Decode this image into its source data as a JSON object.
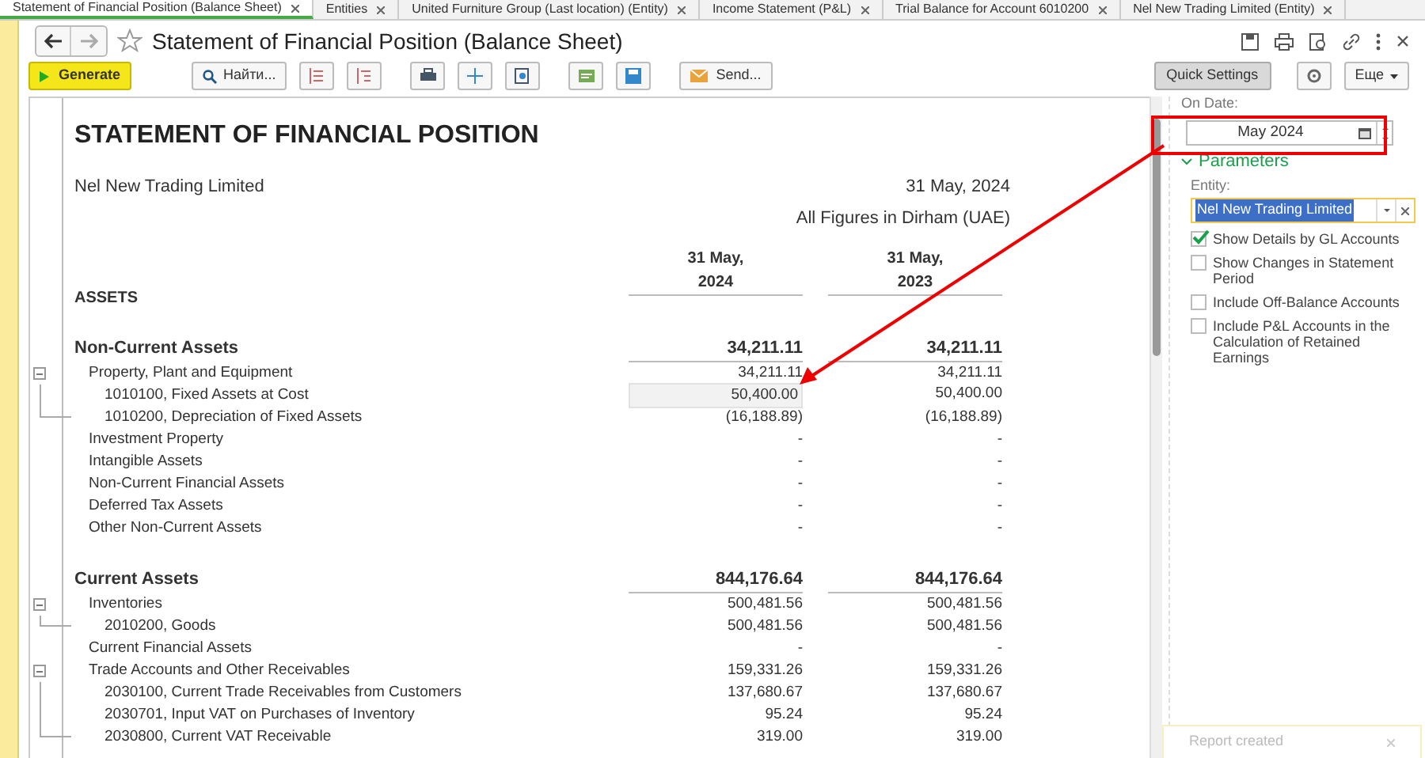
{
  "tabs": [
    {
      "label": "Statement of Financial Position (Balance Sheet)",
      "selected": true
    },
    {
      "label": "Entities",
      "selected": false
    },
    {
      "label": "United Furniture Group (Last location) (Entity)",
      "selected": false
    },
    {
      "label": "Income Statement (P&L)",
      "selected": false
    },
    {
      "label": "Trial Balance for Account 6010200",
      "selected": false
    },
    {
      "label": "Nel New Trading Limited (Entity)",
      "selected": false
    }
  ],
  "window": {
    "title": "Statement of Financial Position (Balance Sheet)"
  },
  "toolbar": {
    "generate": "Generate",
    "find": "Найти...",
    "send": "Send...",
    "quick_settings": "Quick Settings",
    "more": "Еще"
  },
  "report": {
    "title": "STATEMENT OF FINANCIAL POSITION",
    "entity": "Nel New Trading Limited",
    "date": "31 May, 2024",
    "currency_note": "All Figures in Dirham (UAE)",
    "columns": [
      "31 May,\n2024",
      "31 May,\n2023"
    ],
    "rows": [
      {
        "kind": "heading",
        "label": "ASSETS"
      },
      {
        "kind": "section",
        "label": "Non-Current Assets",
        "values": [
          "34,211.11",
          "34,211.11"
        ]
      },
      {
        "kind": "group",
        "label": "Property, Plant and Equipment",
        "values": [
          "34,211.11",
          "34,211.11"
        ],
        "expanded": true,
        "children": [
          {
            "kind": "account",
            "label": "1010100, Fixed Assets at Cost",
            "values": [
              "50,400.00",
              "50,400.00"
            ],
            "selected": true
          },
          {
            "kind": "account",
            "label": "1010200, Depreciation of Fixed Assets",
            "values": [
              "(16,188.89)",
              "(16,188.89)"
            ],
            "selected": false
          }
        ]
      },
      {
        "kind": "group",
        "label": "Investment Property",
        "values": [
          "-",
          "-"
        ]
      },
      {
        "kind": "group",
        "label": "Intangible Assets",
        "values": [
          "-",
          "-"
        ]
      },
      {
        "kind": "group",
        "label": "Non-Current Financial Assets",
        "values": [
          "-",
          "-"
        ]
      },
      {
        "kind": "group",
        "label": "Deferred Tax Assets",
        "values": [
          "-",
          "-"
        ]
      },
      {
        "kind": "group",
        "label": "Other Non-Current Assets",
        "values": [
          "-",
          "-"
        ]
      },
      {
        "kind": "section",
        "label": "Current Assets",
        "values": [
          "844,176.64",
          "844,176.64"
        ]
      },
      {
        "kind": "group",
        "label": "Inventories",
        "values": [
          "500,481.56",
          "500,481.56"
        ],
        "expanded": true,
        "children": [
          {
            "kind": "account",
            "label": "2010200, Goods",
            "values": [
              "500,481.56",
              "500,481.56"
            ],
            "selected": false
          }
        ]
      },
      {
        "kind": "group",
        "label": "Current Financial Assets",
        "values": [
          "-",
          "-"
        ]
      },
      {
        "kind": "group",
        "label": "Trade Accounts and Other Receivables",
        "values": [
          "159,331.26",
          "159,331.26"
        ],
        "expanded": true,
        "children": [
          {
            "kind": "account",
            "label": "2030100, Current Trade Receivables from Customers",
            "values": [
              "137,680.67",
              "137,680.67"
            ],
            "selected": false
          },
          {
            "kind": "account",
            "label": "2030701, Input VAT on Purchases of Inventory",
            "values": [
              "95.24",
              "95.24"
            ],
            "selected": false
          },
          {
            "kind": "account",
            "label": "2030800, Current VAT Receivable",
            "values": [
              "319.00",
              "319.00"
            ],
            "selected": false
          }
        ]
      }
    ]
  },
  "settings": {
    "on_date_label": "On Date:",
    "on_date": "May 2024",
    "parameters_title": "Parameters",
    "entity_label": "Entity:",
    "entity": "Nel New Trading Limited",
    "options": [
      {
        "label": "Show Details by GL Accounts",
        "checked": true
      },
      {
        "label": "Show Changes in Statement Period",
        "checked": false
      },
      {
        "label": "Include Off-Balance Accounts",
        "checked": false
      },
      {
        "label": "Include P&L Accounts in the Calculation of Retained Earnings",
        "checked": false
      }
    ]
  },
  "notification": {
    "text": "Report created"
  }
}
